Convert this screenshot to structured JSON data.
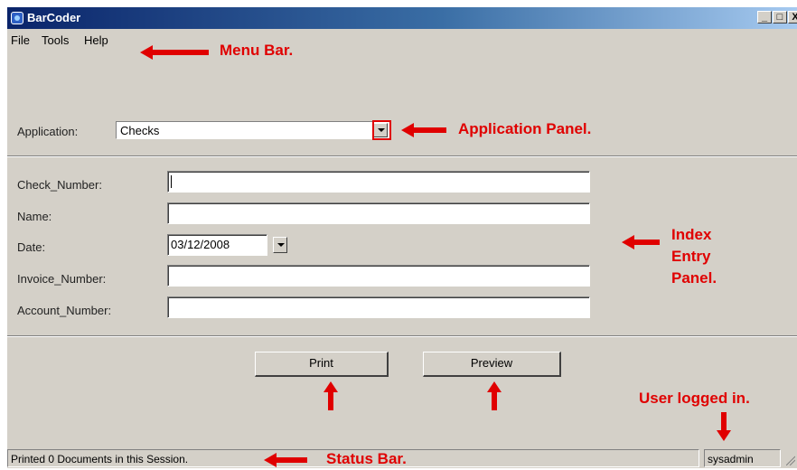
{
  "window": {
    "title": "BarCoder",
    "minimize_label": "_",
    "maximize_label": "□",
    "close_label": "X"
  },
  "menu": {
    "file": "File",
    "tools": "Tools",
    "help": "Help"
  },
  "application_panel": {
    "label": "Application:",
    "selected": "Checks"
  },
  "index_panel": {
    "fields": [
      {
        "label": "Check_Number:",
        "value": ""
      },
      {
        "label": "Name:",
        "value": ""
      },
      {
        "label": "Date:",
        "value": "03/12/2008"
      },
      {
        "label": "Invoice_Number:",
        "value": ""
      },
      {
        "label": "Account_Number:",
        "value": ""
      }
    ]
  },
  "buttons": {
    "print": "Print",
    "preview": "Preview"
  },
  "status": {
    "message": "Printed 0 Documents in this Session.",
    "user": "sysadmin"
  },
  "annotations": {
    "menu_bar": "Menu Bar.",
    "application_panel": "Application Panel.",
    "index_entry_line1": "Index",
    "index_entry_line2": "Entry",
    "index_entry_line3": "Panel.",
    "user_logged_in": "User logged in.",
    "status_bar": "Status Bar."
  },
  "colors": {
    "annotation": "#e00000",
    "window_face": "#d4d0c8",
    "titlebar_start": "#0a246a",
    "titlebar_end": "#a6caf0"
  }
}
